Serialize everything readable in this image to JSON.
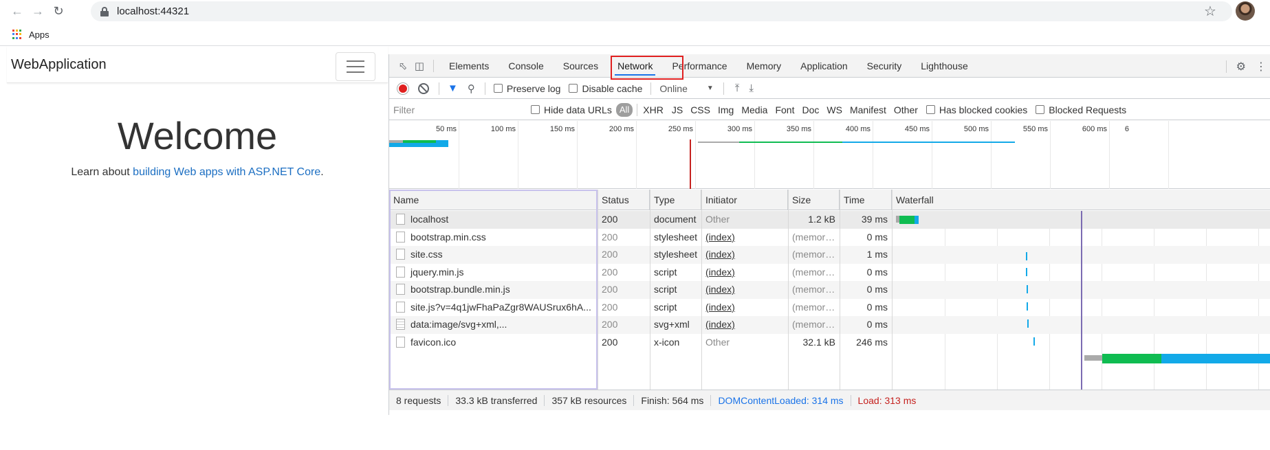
{
  "browser": {
    "url": "localhost:44321",
    "bookmarks_apps": "Apps"
  },
  "page": {
    "brand": "WebApplication",
    "welcome": "Welcome",
    "learn_prefix": "Learn about ",
    "learn_link": "building Web apps with ASP.NET Core",
    "learn_suffix": "."
  },
  "devtools": {
    "tabs": [
      "Elements",
      "Console",
      "Sources",
      "Network",
      "Performance",
      "Memory",
      "Application",
      "Security",
      "Lighthouse"
    ],
    "active_tab": "Network",
    "toolbar": {
      "preserve_log": "Preserve log",
      "disable_cache": "Disable cache",
      "throttle": "Online"
    },
    "filterbar": {
      "filter_placeholder": "Filter",
      "hide_data_urls": "Hide data URLs",
      "types": [
        "All",
        "XHR",
        "JS",
        "CSS",
        "Img",
        "Media",
        "Font",
        "Doc",
        "WS",
        "Manifest",
        "Other"
      ],
      "has_blocked_cookies": "Has blocked cookies",
      "blocked_requests": "Blocked Requests"
    },
    "overview_ticks": [
      "50 ms",
      "100 ms",
      "150 ms",
      "200 ms",
      "250 ms",
      "300 ms",
      "350 ms",
      "400 ms",
      "450 ms",
      "500 ms",
      "550 ms",
      "600 ms",
      "6"
    ],
    "columns": {
      "name": "Name",
      "status": "Status",
      "type": "Type",
      "initiator": "Initiator",
      "size": "Size",
      "time": "Time",
      "waterfall": "Waterfall"
    },
    "requests": [
      {
        "name": "localhost",
        "status": "200",
        "type": "document",
        "initiator": "Other",
        "size": "1.2 kB",
        "time": "39 ms",
        "icon": "document-icon"
      },
      {
        "name": "bootstrap.min.css",
        "status": "200",
        "type": "stylesheet",
        "initiator": "(index)",
        "size": "(memory ...",
        "time": "0 ms",
        "icon": "document-icon"
      },
      {
        "name": "site.css",
        "status": "200",
        "type": "stylesheet",
        "initiator": "(index)",
        "size": "(memory ...",
        "time": "1 ms",
        "icon": "document-icon"
      },
      {
        "name": "jquery.min.js",
        "status": "200",
        "type": "script",
        "initiator": "(index)",
        "size": "(memory ...",
        "time": "0 ms",
        "icon": "document-icon"
      },
      {
        "name": "bootstrap.bundle.min.js",
        "status": "200",
        "type": "script",
        "initiator": "(index)",
        "size": "(memory ...",
        "time": "0 ms",
        "icon": "document-icon"
      },
      {
        "name": "site.js?v=4q1jwFhaPaZgr8WAUSrux6hA...",
        "status": "200",
        "type": "script",
        "initiator": "(index)",
        "size": "(memory ...",
        "time": "0 ms",
        "icon": "document-icon"
      },
      {
        "name": "data:image/svg+xml,...",
        "status": "200",
        "type": "svg+xml",
        "initiator": "(index)",
        "size": "(memory ...",
        "time": "0 ms",
        "icon": "image-icon"
      },
      {
        "name": "favicon.ico",
        "status": "200",
        "type": "x-icon",
        "initiator": "Other",
        "size": "32.1 kB",
        "time": "246 ms",
        "icon": "document-icon"
      }
    ],
    "summary": {
      "requests": "8 requests",
      "transferred": "33.3 kB transferred",
      "resources": "357 kB resources",
      "finish": "Finish: 564 ms",
      "dom_loaded": "DOMContentLoaded: 314 ms",
      "load": "Load: 313 ms"
    },
    "colors": {
      "accent": "#1a73e8",
      "record": "#e0201f",
      "highlight": "#e02020",
      "dom_loaded": "#1a73e8",
      "load": "#c5221f",
      "wait_bar": "#aaaaaa",
      "download_green": "#0fbc51",
      "receive_blue": "#12a9e8",
      "dom_line": "#7b6bb2"
    }
  }
}
